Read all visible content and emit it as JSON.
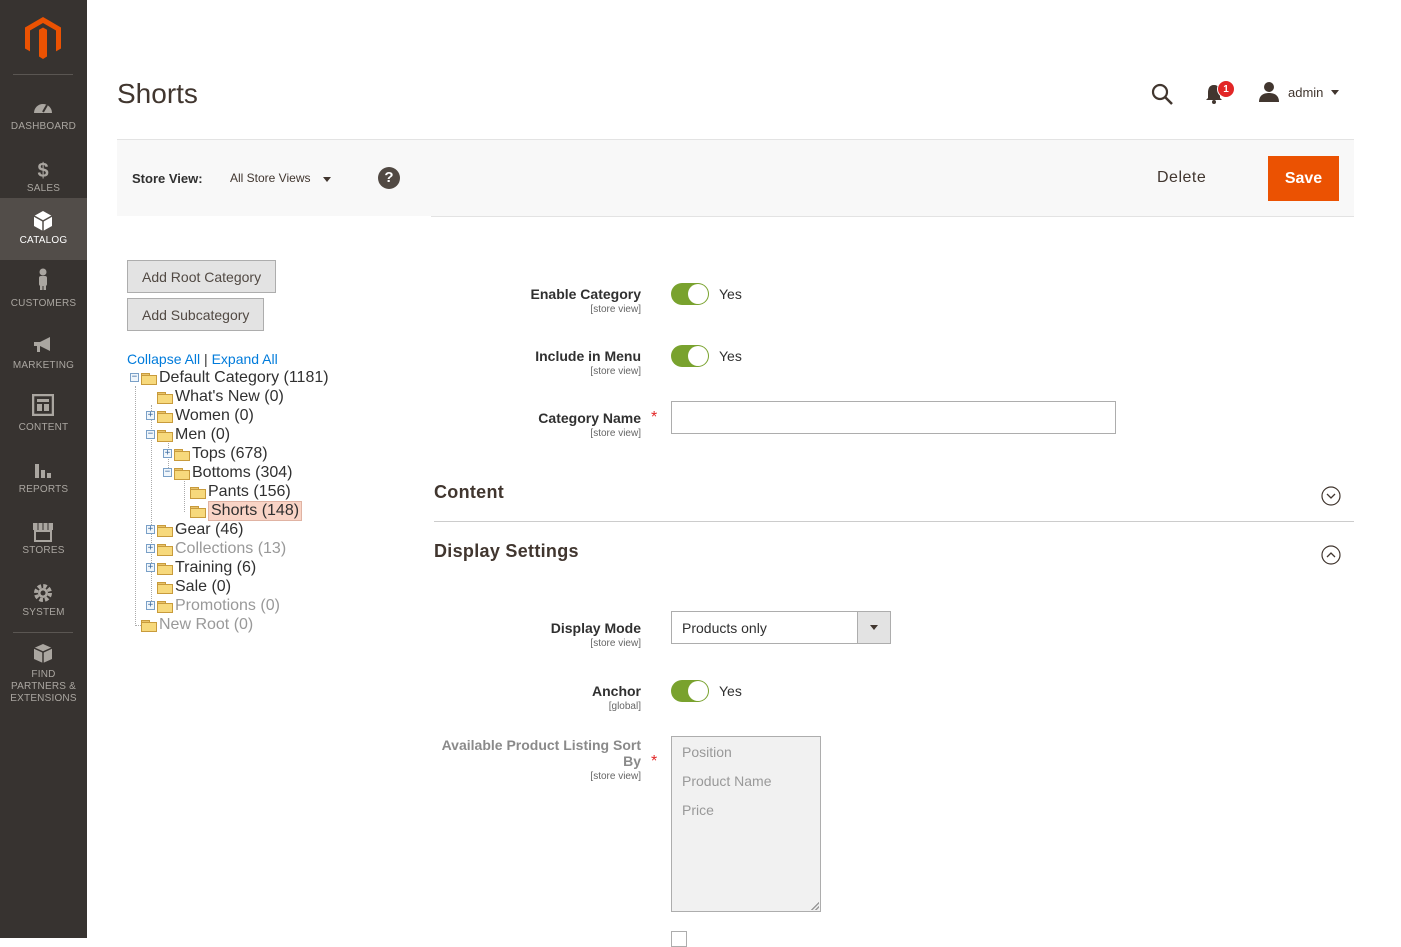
{
  "sidebar": {
    "items": [
      {
        "label": "DASHBOARD",
        "icon": "dashboard-icon"
      },
      {
        "label": "SALES",
        "icon": "dollar-icon"
      },
      {
        "label": "CATALOG",
        "icon": "box-icon"
      },
      {
        "label": "CUSTOMERS",
        "icon": "person-icon"
      },
      {
        "label": "MARKETING",
        "icon": "megaphone-icon"
      },
      {
        "label": "CONTENT",
        "icon": "layout-icon"
      },
      {
        "label": "REPORTS",
        "icon": "bar-chart-icon"
      },
      {
        "label": "STORES",
        "icon": "storefront-icon"
      },
      {
        "label": "SYSTEM",
        "icon": "gear-icon"
      },
      {
        "label": "FIND PARTNERS & EXTENSIONS",
        "icon": "extensions-icon"
      }
    ],
    "active": "CATALOG"
  },
  "header": {
    "title": "Shorts",
    "notification_count": "1",
    "user_name": "admin"
  },
  "store_bar": {
    "label": "Store View:",
    "value": "All Store Views",
    "help": "?"
  },
  "actions": {
    "delete_label": "Delete",
    "save_label": "Save"
  },
  "tree_panel": {
    "add_root_label": "Add Root Category",
    "add_sub_label": "Add Subcategory",
    "collapse_all": "Collapse All",
    "separator": "|",
    "expand_all": "Expand All",
    "nodes": [
      {
        "label": "Default Category (1181)"
      },
      {
        "label": "What's New (0)"
      },
      {
        "label": "Women (0)"
      },
      {
        "label": "Men (0)"
      },
      {
        "label": "Tops (678)"
      },
      {
        "label": "Bottoms (304)"
      },
      {
        "label": "Pants (156)"
      },
      {
        "label": "Shorts (148)"
      },
      {
        "label": "Gear (46)"
      },
      {
        "label": "Collections (13)"
      },
      {
        "label": "Training (6)"
      },
      {
        "label": "Sale (0)"
      },
      {
        "label": "Promotions (0)"
      },
      {
        "label": "New Root (0)"
      }
    ]
  },
  "form": {
    "enable_category": {
      "label": "Enable Category",
      "scope": "[store view]",
      "value": "Yes"
    },
    "include_in_menu": {
      "label": "Include in Menu",
      "scope": "[store view]",
      "value": "Yes"
    },
    "category_name": {
      "label": "Category Name",
      "scope": "[store view]",
      "value": ""
    },
    "required_mark": "*"
  },
  "sections": {
    "content": "Content",
    "display_settings": "Display Settings"
  },
  "display": {
    "display_mode": {
      "label": "Display Mode",
      "scope": "[store view]",
      "value": "Products only"
    },
    "anchor": {
      "label": "Anchor",
      "scope": "[global]",
      "value": "Yes"
    },
    "sort_by": {
      "label_line1": "Available Product Listing Sort",
      "label_line2": "By",
      "scope": "[store view]",
      "options": [
        "Position",
        "Product Name",
        "Price"
      ]
    }
  },
  "colors": {
    "sidebar_bg": "#373330",
    "accent": "#eb5202",
    "toggle_on": "#79a22e",
    "link": "#007bdb"
  }
}
